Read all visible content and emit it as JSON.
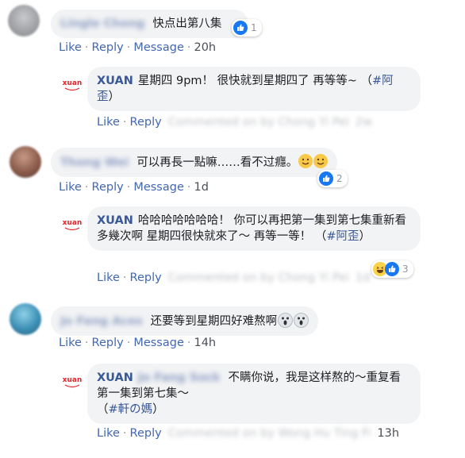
{
  "comments": [
    {
      "author": "Lingle Chong",
      "text": "快点出第八集",
      "reactions": "1",
      "actions": {
        "like": "Like",
        "reply": "Reply",
        "message": "Message",
        "time": "20h"
      },
      "reply": {
        "author": "XUAN",
        "text": "星期四 9pm！ 很快就到星期四了 再等等~ （",
        "hashtag": "#阿歪",
        "text_end": "）",
        "actions": {
          "like": "Like",
          "reply": "Reply",
          "edited": "Commented on by Chong Yi Pei",
          "time": "2w"
        }
      }
    },
    {
      "author": "Thong Wei",
      "text": "可以再長一點嘛……看不过癮。",
      "reactions": "2",
      "actions": {
        "like": "Like",
        "reply": "Reply",
        "message": "Message",
        "time": "1d"
      },
      "reply": {
        "author": "XUAN",
        "text": "哈哈哈哈哈哈哈！ 你可以再把第一集到第七集重新看多幾次啊 星期四很快就來了～ 再等一等！ （",
        "hashtag": "#阿歪",
        "text_end": "）",
        "reactions": "3",
        "actions": {
          "like": "Like",
          "reply": "Reply",
          "edited": "Commented on by Chong Yi Pei",
          "time": "1d"
        }
      }
    },
    {
      "author": "Jo Feng Aces",
      "text": "还要等到星期四好难熬啊",
      "actions": {
        "like": "Like",
        "reply": "Reply",
        "message": "Message",
        "time": "14h"
      },
      "reply": {
        "author": "XUAN",
        "author_hidden": "Jo Fang Sock",
        "text": "不瞒你说，我是这样熬的～重复看第一集到第七集～",
        "hashtag_prefix": "（",
        "hashtag": "#軒の媽",
        "text_end": "）",
        "actions": {
          "like": "Like",
          "reply": "Reply",
          "edited": "Commented on by Wong Hu Ting Fi",
          "time": "13h"
        }
      }
    }
  ],
  "colors": {
    "link": "#4267b2",
    "name": "#385898",
    "bubble": "#f2f3f5",
    "logo_red": "#e0242b"
  }
}
